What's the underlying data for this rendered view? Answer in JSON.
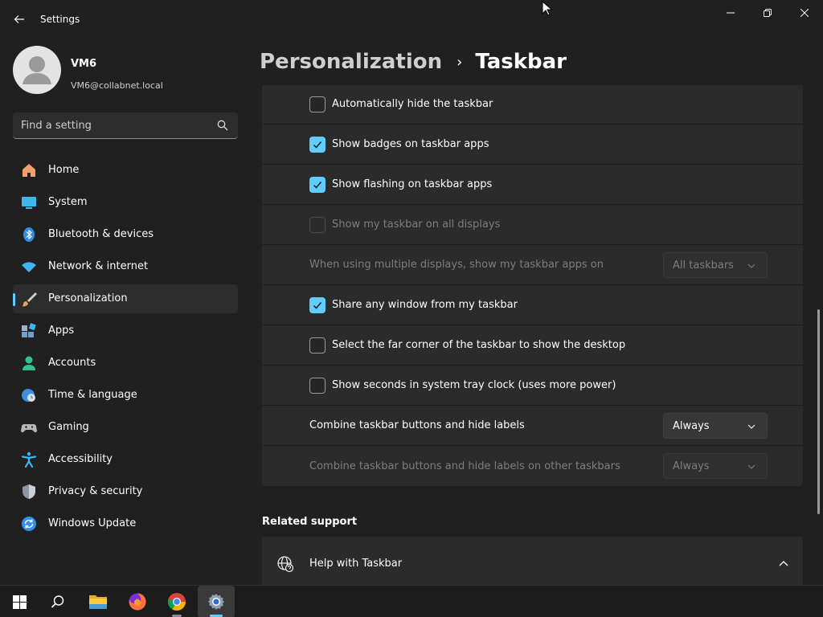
{
  "window": {
    "title": "Settings"
  },
  "profile": {
    "name": "VM6",
    "email": "VM6@collabnet.local"
  },
  "search": {
    "placeholder": "Find a setting"
  },
  "nav": {
    "items": [
      {
        "label": "Home",
        "icon": "home-icon"
      },
      {
        "label": "System",
        "icon": "monitor-icon"
      },
      {
        "label": "Bluetooth & devices",
        "icon": "bluetooth-icon"
      },
      {
        "label": "Network & internet",
        "icon": "wifi-icon"
      },
      {
        "label": "Personalization",
        "icon": "brush-icon",
        "active": true
      },
      {
        "label": "Apps",
        "icon": "apps-icon"
      },
      {
        "label": "Accounts",
        "icon": "person-icon"
      },
      {
        "label": "Time & language",
        "icon": "clock-globe-icon"
      },
      {
        "label": "Gaming",
        "icon": "gamepad-icon"
      },
      {
        "label": "Accessibility",
        "icon": "accessibility-icon"
      },
      {
        "label": "Privacy & security",
        "icon": "shield-icon"
      },
      {
        "label": "Windows Update",
        "icon": "update-icon"
      }
    ]
  },
  "breadcrumb": {
    "parent": "Personalization",
    "separator": "›",
    "current": "Taskbar"
  },
  "behaviors": {
    "rows": [
      {
        "type": "checkbox",
        "label": "Automatically hide the taskbar",
        "checked": false,
        "disabled": false
      },
      {
        "type": "checkbox",
        "label": "Show badges on taskbar apps",
        "checked": true,
        "disabled": false
      },
      {
        "type": "checkbox",
        "label": "Show flashing on taskbar apps",
        "checked": true,
        "disabled": false
      },
      {
        "type": "checkbox",
        "label": "Show my taskbar on all displays",
        "checked": false,
        "disabled": true
      },
      {
        "type": "select",
        "label": "When using multiple displays, show my taskbar apps on",
        "value": "All taskbars",
        "disabled": true
      },
      {
        "type": "checkbox",
        "label": "Share any window from my taskbar",
        "checked": true,
        "disabled": false
      },
      {
        "type": "checkbox",
        "label": "Select the far corner of the taskbar to show the desktop",
        "checked": false,
        "disabled": false
      },
      {
        "type": "checkbox",
        "label": "Show seconds in system tray clock (uses more power)",
        "checked": false,
        "disabled": false
      },
      {
        "type": "select",
        "label": "Combine taskbar buttons and hide labels",
        "value": "Always",
        "disabled": false
      },
      {
        "type": "select",
        "label": "Combine taskbar buttons and hide labels on other taskbars",
        "value": "Always",
        "disabled": true
      }
    ]
  },
  "related": {
    "title": "Related support",
    "help_label": "Help with Taskbar"
  },
  "colors": {
    "accent": "#60cdff",
    "background": "#202020",
    "card": "#2b2b2b"
  }
}
